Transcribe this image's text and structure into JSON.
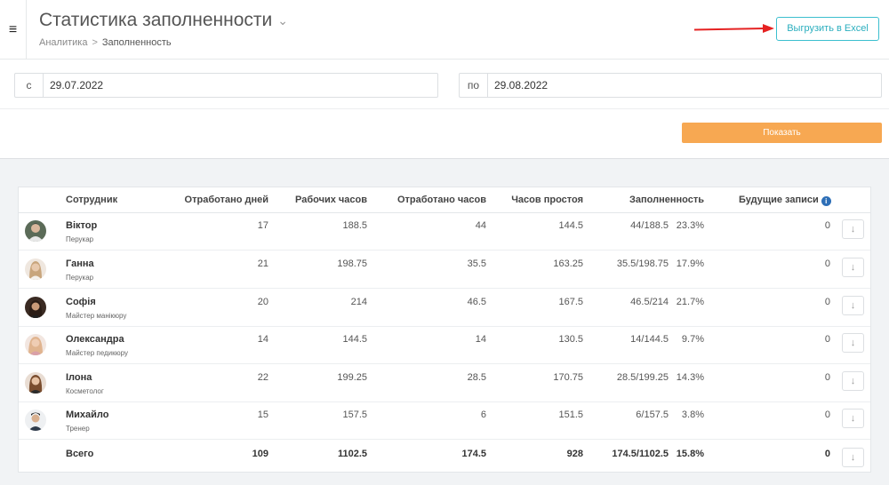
{
  "header": {
    "title": "Статистика заполненности",
    "breadcrumb": [
      "Аналитика",
      "Заполненность"
    ],
    "export_label": "Выгрузить в Excel"
  },
  "filters": {
    "from_label": "с",
    "from_value": "29.07.2022",
    "to_label": "по",
    "to_value": "29.08.2022",
    "show_label": "Показать"
  },
  "table": {
    "columns": [
      "Сотрудник",
      "Отработано дней",
      "Рабочих часов",
      "Отработано часов",
      "Часов простоя",
      "Заполненность",
      "Будущие записи"
    ],
    "rows": [
      {
        "name": "Віктор",
        "role": "Перукар",
        "days": "17",
        "work_hours": "188.5",
        "worked": "44",
        "idle": "144.5",
        "fill": "44/188.5",
        "pct": "23.3%",
        "future": "0"
      },
      {
        "name": "Ганна",
        "role": "Перукар",
        "days": "21",
        "work_hours": "198.75",
        "worked": "35.5",
        "idle": "163.25",
        "fill": "35.5/198.75",
        "pct": "17.9%",
        "future": "0"
      },
      {
        "name": "Софія",
        "role": "Майстер манікюру",
        "days": "20",
        "work_hours": "214",
        "worked": "46.5",
        "idle": "167.5",
        "fill": "46.5/214",
        "pct": "21.7%",
        "future": "0"
      },
      {
        "name": "Олександра",
        "role": "Майстер педикюру",
        "days": "14",
        "work_hours": "144.5",
        "worked": "14",
        "idle": "130.5",
        "fill": "14/144.5",
        "pct": "9.7%",
        "future": "0"
      },
      {
        "name": "Ілона",
        "role": "Косметолог",
        "days": "22",
        "work_hours": "199.25",
        "worked": "28.5",
        "idle": "170.75",
        "fill": "28.5/199.25",
        "pct": "14.3%",
        "future": "0"
      },
      {
        "name": "Михайло",
        "role": "Тренер",
        "days": "15",
        "work_hours": "157.5",
        "worked": "6",
        "idle": "151.5",
        "fill": "6/157.5",
        "pct": "3.8%",
        "future": "0"
      }
    ],
    "total": {
      "name": "Всего",
      "days": "109",
      "work_hours": "1102.5",
      "worked": "174.5",
      "idle": "928",
      "fill": "174.5/1102.5",
      "pct": "15.8%",
      "future": "0"
    }
  },
  "icons": {
    "menu": "hamburger-icon",
    "title_toggle": "chevron-down-icon",
    "info": "info-icon",
    "download": "arrow-down-icon",
    "annotation": "red-arrow"
  },
  "colors": {
    "accent": "#3bbfcf",
    "show_button": "#f7a852",
    "annotation_arrow": "#e52222",
    "info_icon": "#2e6fb7"
  }
}
